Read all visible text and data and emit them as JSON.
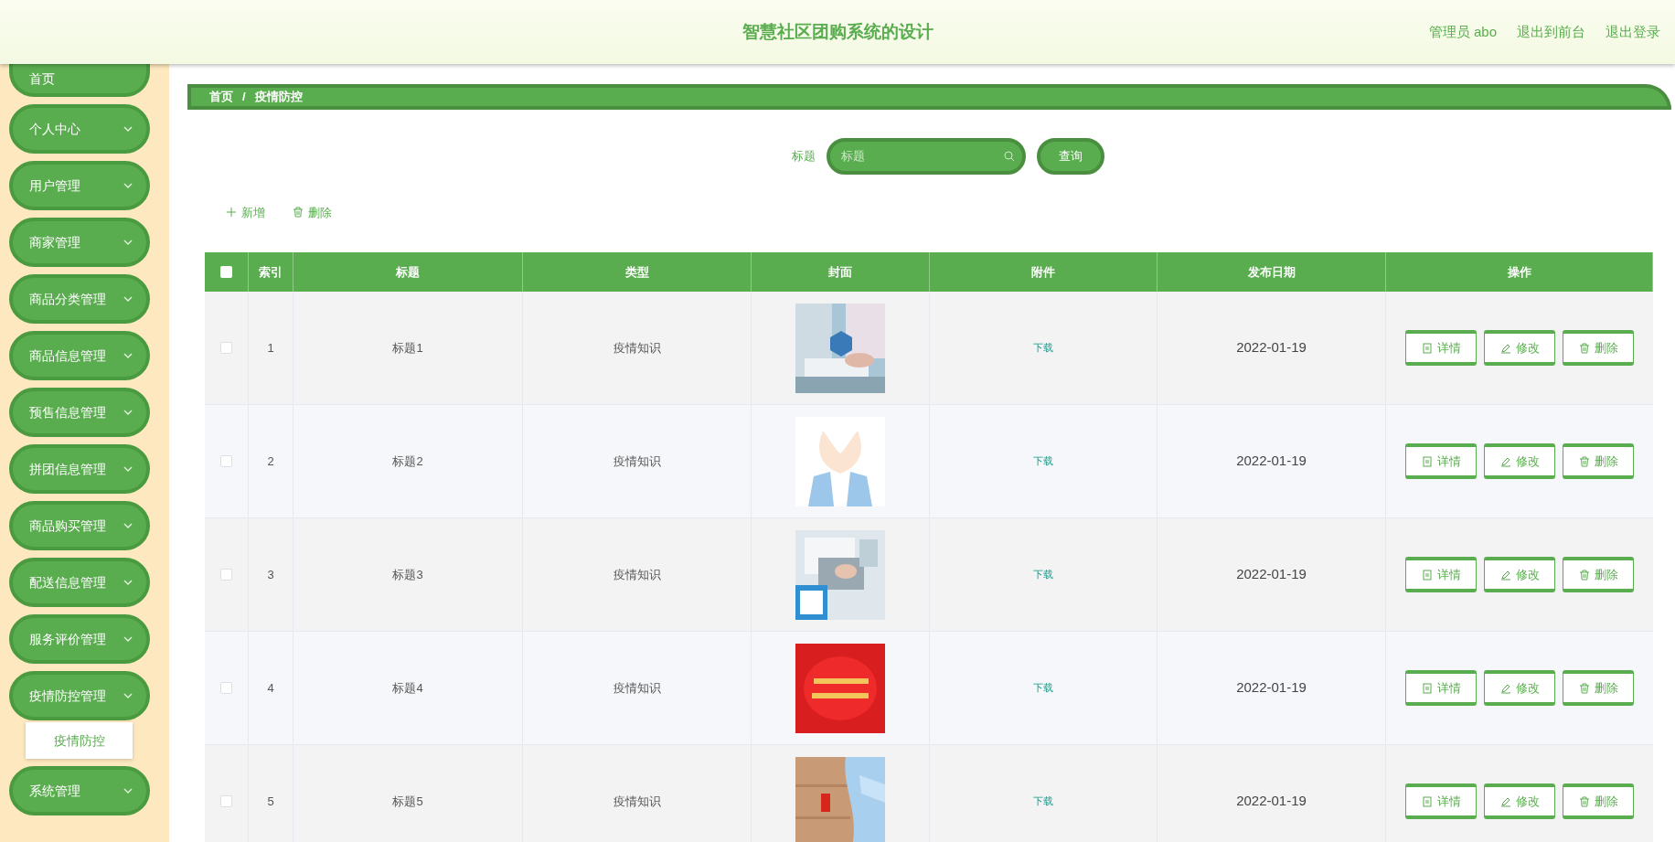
{
  "header": {
    "title": "智慧社区团购系统的设计",
    "links": [
      "管理员 abo",
      "退出到前台",
      "退出登录"
    ]
  },
  "sidebar": {
    "items": [
      {
        "label": "首页",
        "kind": "link"
      },
      {
        "label": "个人中心",
        "kind": "menu"
      },
      {
        "label": "用户管理",
        "kind": "menu"
      },
      {
        "label": "商家管理",
        "kind": "menu"
      },
      {
        "label": "商品分类管理",
        "kind": "menu"
      },
      {
        "label": "商品信息管理",
        "kind": "menu"
      },
      {
        "label": "预售信息管理",
        "kind": "menu"
      },
      {
        "label": "拼团信息管理",
        "kind": "menu"
      },
      {
        "label": "商品购买管理",
        "kind": "menu"
      },
      {
        "label": "配送信息管理",
        "kind": "menu"
      },
      {
        "label": "服务评价管理",
        "kind": "menu"
      },
      {
        "label": "疫情防控管理",
        "kind": "menu",
        "children": [
          {
            "label": "疫情防控"
          }
        ]
      },
      {
        "label": "系统管理",
        "kind": "menu"
      }
    ]
  },
  "breadcrumb": [
    "首页",
    "/",
    "疫情防控"
  ],
  "search": {
    "label": "标题",
    "placeholder": "标题",
    "button": "查询"
  },
  "toolbar": {
    "add": "新增",
    "delete": "删除"
  },
  "table": {
    "select_all": {
      "checked": false
    },
    "columns": [
      "索引",
      "标题",
      "类型",
      "封面",
      "附件",
      "发布日期",
      "操作"
    ],
    "rows": [
      {
        "checked": false,
        "index": "1",
        "title": "标题1",
        "type": "疫情知识",
        "attachment": "下载",
        "date": "2022-01-19",
        "actions": [
          "详情",
          "修改",
          "删除"
        ]
      },
      {
        "checked": false,
        "index": "2",
        "title": "标题2",
        "type": "疫情知识",
        "attachment": "下载",
        "date": "2022-01-19",
        "actions": [
          "详情",
          "修改",
          "删除"
        ]
      },
      {
        "checked": false,
        "index": "3",
        "title": "标题3",
        "type": "疫情知识",
        "attachment": "下载",
        "date": "2022-01-19",
        "actions": [
          "详情",
          "修改",
          "删除"
        ]
      },
      {
        "checked": false,
        "index": "4",
        "title": "标题4",
        "type": "疫情知识",
        "attachment": "下载",
        "date": "2022-01-19",
        "actions": [
          "详情",
          "修改",
          "删除"
        ]
      },
      {
        "checked": false,
        "index": "5",
        "title": "标题5",
        "type": "疫情知识",
        "attachment": "下载",
        "date": "2022-01-19",
        "actions": [
          "详情",
          "修改",
          "删除"
        ]
      }
    ]
  }
}
